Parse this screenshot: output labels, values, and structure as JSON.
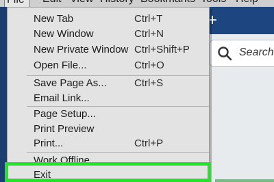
{
  "menubar": {
    "items": [
      "File",
      "Edit",
      "View",
      "History",
      "Bookmarks",
      "Tools",
      "Help"
    ]
  },
  "browser": {
    "new_tab_icon": "plus-icon",
    "search_placeholder": "Search"
  },
  "file_menu": {
    "items": [
      {
        "label": "New Tab",
        "shortcut": "Ctrl+T"
      },
      {
        "label": "New Window",
        "shortcut": "Ctrl+N"
      },
      {
        "label": "New Private Window",
        "shortcut": "Ctrl+Shift+P"
      },
      {
        "label": "Open File...",
        "shortcut": "Ctrl+O"
      },
      {
        "label": "Save Page As...",
        "shortcut": "Ctrl+S"
      },
      {
        "label": "Email Link...",
        "shortcut": ""
      },
      {
        "label": "Page Setup...",
        "shortcut": ""
      },
      {
        "label": "Print Preview",
        "shortcut": ""
      },
      {
        "label": "Print...",
        "shortcut": "Ctrl+P"
      },
      {
        "label": "Work Offline",
        "shortcut": ""
      },
      {
        "label": "Exit",
        "shortcut": ""
      }
    ]
  },
  "colors": {
    "highlight": "#28e12c",
    "menu_bg": "#e3e3e3",
    "toolbar_bg": "#1d4681"
  }
}
